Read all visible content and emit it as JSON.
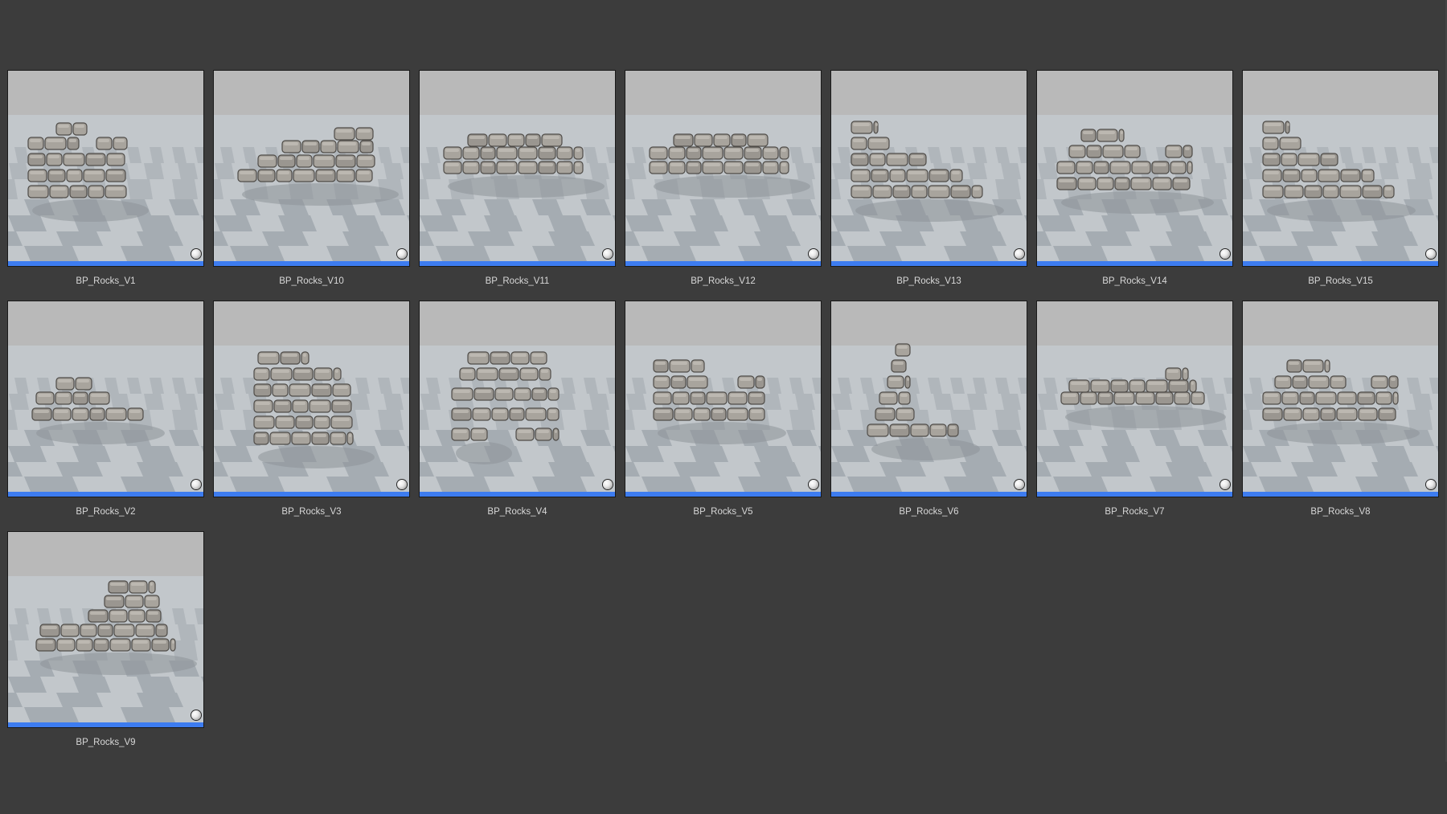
{
  "asset_browser": {
    "type_color": "#3d7cf0",
    "thumbnail_icon": "sphere-icon",
    "assets": [
      {
        "name": "BP_Rocks_V1",
        "shape": "wall-corner"
      },
      {
        "name": "BP_Rocks_V10",
        "shape": "wall-long"
      },
      {
        "name": "BP_Rocks_V11",
        "shape": "wall-long-low"
      },
      {
        "name": "BP_Rocks_V12",
        "shape": "wall-long-low"
      },
      {
        "name": "BP_Rocks_V13",
        "shape": "wall-sloped"
      },
      {
        "name": "BP_Rocks_V14",
        "shape": "wall-ruin"
      },
      {
        "name": "BP_Rocks_V15",
        "shape": "wall-sloped"
      },
      {
        "name": "BP_Rocks_V2",
        "shape": "rubble"
      },
      {
        "name": "BP_Rocks_V3",
        "shape": "wall-tall"
      },
      {
        "name": "BP_Rocks_V4",
        "shape": "arch"
      },
      {
        "name": "BP_Rocks_V5",
        "shape": "wall-broken"
      },
      {
        "name": "BP_Rocks_V6",
        "shape": "pillar"
      },
      {
        "name": "BP_Rocks_V7",
        "shape": "rubble-low"
      },
      {
        "name": "BP_Rocks_V8",
        "shape": "wall-ruin"
      },
      {
        "name": "BP_Rocks_V9",
        "shape": "wall-step"
      }
    ]
  }
}
